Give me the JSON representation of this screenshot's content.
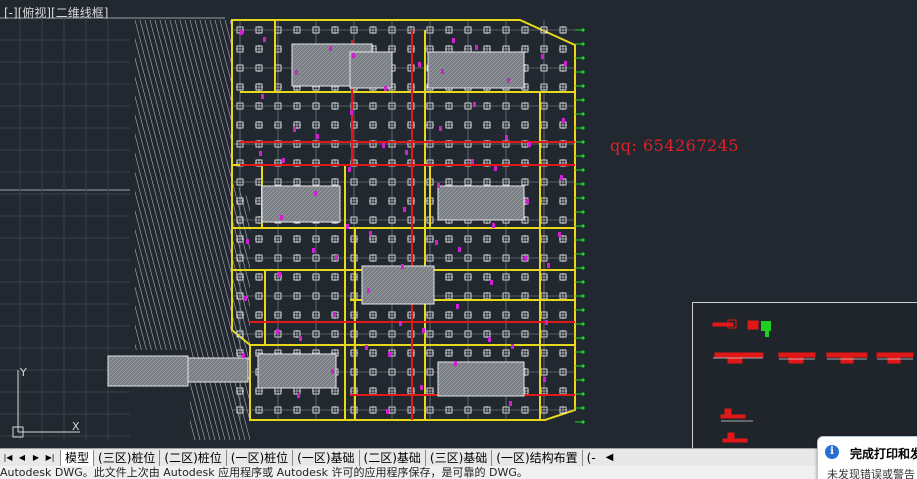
{
  "viewport": {
    "label": "[-][俯视][二维线框]"
  },
  "watermark": {
    "qq_text": "qq: 654267245"
  },
  "ucs": {
    "y_label": "Y",
    "x_label": "X"
  },
  "tabs": {
    "items": [
      {
        "label": "模型",
        "active": true
      },
      {
        "label": "(三区)桩位",
        "active": false
      },
      {
        "label": "(二区)桩位",
        "active": false
      },
      {
        "label": "(一区)桩位",
        "active": false
      },
      {
        "label": "(一区)基础",
        "active": false
      },
      {
        "label": "(二区)基础",
        "active": false
      },
      {
        "label": "(三区)基础",
        "active": false
      },
      {
        "label": "(一区)结构布置",
        "active": false
      },
      {
        "label": "(-",
        "active": false
      }
    ]
  },
  "statusbar": {
    "text": "Autodesk DWG。此文件上次由 Autodesk 应用程序或 Autodesk 许可的应用程序保存，是可靠的 DWG。"
  },
  "notification": {
    "title": "完成打印和发",
    "body": "未发现错误或警告"
  },
  "colors": {
    "background": "#212830",
    "grid": "#ffffff",
    "beam_yellow": "#e8d81a",
    "beam_red": "#e01818",
    "accent_magenta": "#d020d0",
    "green": "#20d020"
  }
}
